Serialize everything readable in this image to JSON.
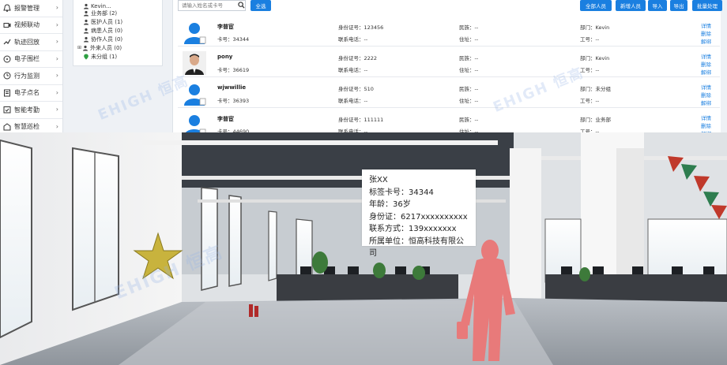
{
  "nav": {
    "items": [
      {
        "label": "报警管理",
        "icon": "alarm-icon"
      },
      {
        "label": "视频联动",
        "icon": "video-icon"
      },
      {
        "label": "轨迹回放",
        "icon": "track-icon"
      },
      {
        "label": "电子围栏",
        "icon": "fence-icon"
      },
      {
        "label": "行为监测",
        "icon": "behavior-icon"
      },
      {
        "label": "电子点名",
        "icon": "rollcall-icon"
      },
      {
        "label": "智能考勤",
        "icon": "attendance-icon"
      },
      {
        "label": "智慧巡检",
        "icon": "patrol-icon"
      }
    ]
  },
  "tree": {
    "rows": [
      {
        "label": "Kevin..."
      },
      {
        "label": "业务部 (2)"
      },
      {
        "label": "医护人员 (1)"
      },
      {
        "label": "病患人员 (0)"
      },
      {
        "label": "协作人员 (0)"
      },
      {
        "label": "外来人员 (0)"
      },
      {
        "label": "未分组 (1)"
      }
    ]
  },
  "toolbar": {
    "search_placeholder": "请输入姓名或卡号",
    "all_label": "全选",
    "buttons": [
      "全部人员",
      "新增人员",
      "导入",
      "导出",
      "批量处理"
    ]
  },
  "people": [
    {
      "name": "李普宦",
      "card": "卡号：34344",
      "id": "身份证号：123456",
      "phone": "联系电话：--",
      "ethnic": "民族：--",
      "addr": "住址：--",
      "dept": "部门：Kevin",
      "job": "工号：--",
      "photo": false
    },
    {
      "name": "pony",
      "card": "卡号：36619",
      "id": "身份证号：2222",
      "phone": "联系电话：--",
      "ethnic": "民族：--",
      "addr": "住址：--",
      "dept": "部门：Kevin",
      "job": "工号：--",
      "photo": true
    },
    {
      "name": "wjwwillie",
      "card": "卡号：36393",
      "id": "身份证号：510",
      "phone": "联系电话：--",
      "ethnic": "民族：--",
      "addr": "住址：--",
      "dept": "部门：未分组",
      "job": "工号：--",
      "photo": false
    },
    {
      "name": "李普宦",
      "card": "卡号：44690",
      "id": "身份证号：111111",
      "phone": "联系电话：--",
      "ethnic": "民族：--",
      "addr": "住址：--",
      "dept": "部门：业务部",
      "job": "工号：--",
      "photo": false
    }
  ],
  "actions": [
    "详情",
    "删除",
    "解绑"
  ],
  "watermark": "EHIGH 恒高",
  "info_card": {
    "lines": [
      "张XX",
      "标签卡号：34344",
      "年龄：36岁",
      "身份证：6217xxxxxxxxxx",
      "联系方式：139xxxxxxx",
      "所属单位：恒高科技有限公司"
    ]
  },
  "colors": {
    "accent": "#1a7fe0",
    "person_silhouette": "#e87a7a",
    "dashline": "#e57b8a"
  }
}
